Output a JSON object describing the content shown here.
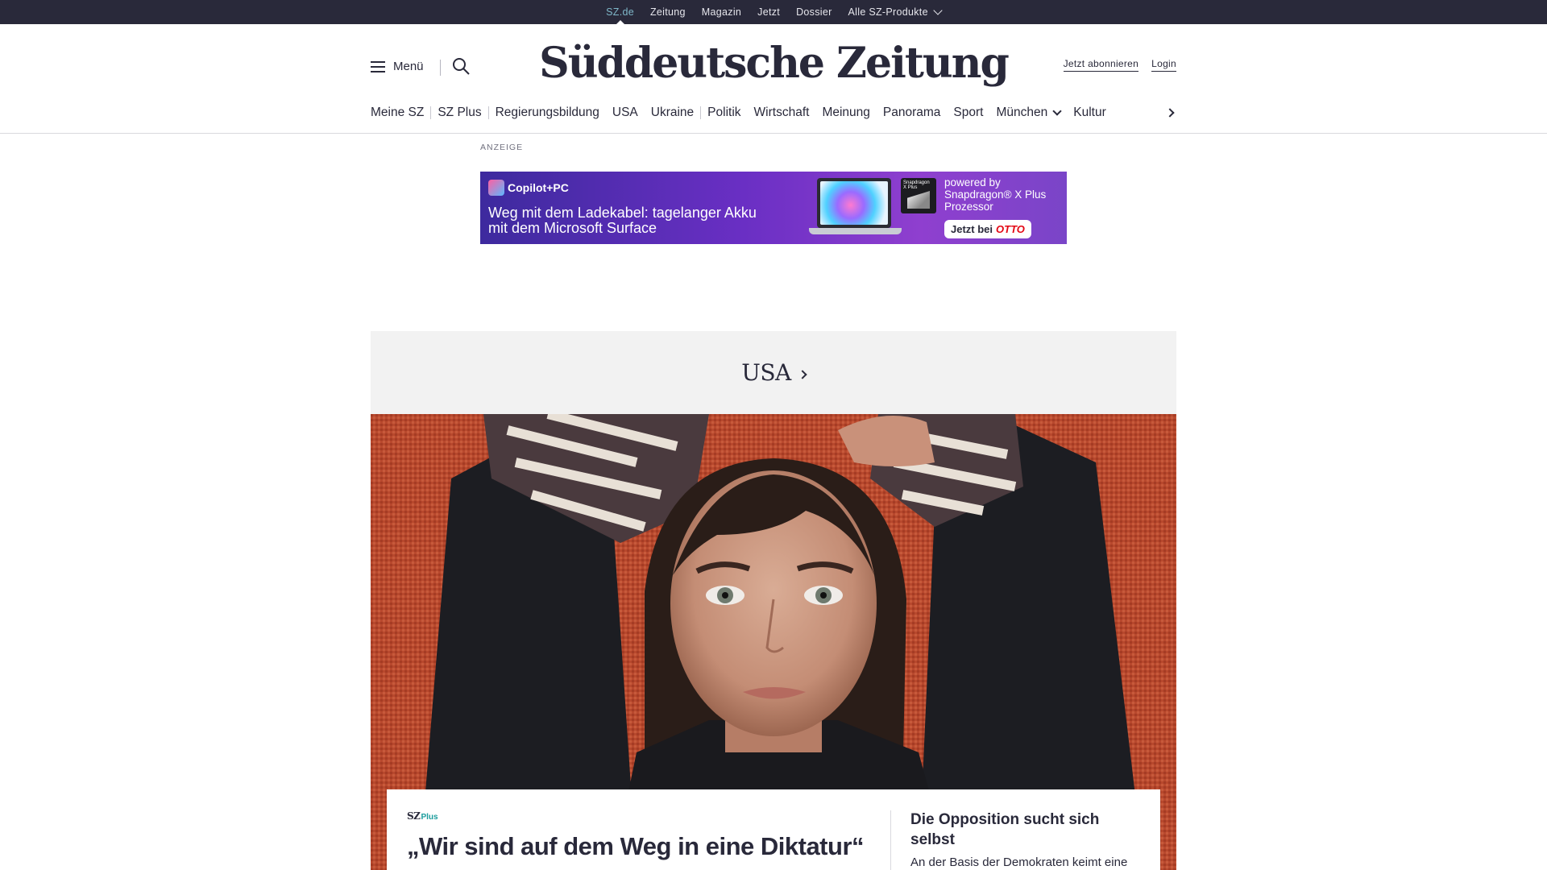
{
  "topbar": {
    "items": [
      "SZ.de",
      "Zeitung",
      "Magazin",
      "Jetzt",
      "Dossier",
      "Alle SZ-Produkte"
    ],
    "active": "SZ.de"
  },
  "header": {
    "menu_label": "Menü",
    "logo_text": "Süddeutsche Zeitung",
    "subscribe_label": "Jetzt abonnieren",
    "login_label": "Login"
  },
  "nav": {
    "items": [
      "Meine SZ",
      "SZ Plus",
      "Regierungsbildung",
      "USA",
      "Ukraine",
      "Politik",
      "Wirtschaft",
      "Meinung",
      "Panorama",
      "Sport",
      "München",
      "Kultur"
    ]
  },
  "ad": {
    "label": "ANZEIGE",
    "brand": "Copilot+PC",
    "headline": "Weg mit dem Ladekabel: tagelanger Akku mit dem Microsoft Surface",
    "chip_text": "Snapdragon X Plus",
    "powered": "powered by Snapdragon® X Plus Prozessor",
    "cta": "Jetzt bei",
    "cta_brand": "OTTO"
  },
  "section": {
    "title": "USA"
  },
  "teaser_main": {
    "badge_sz": "SZ",
    "badge_plus": "Plus",
    "headline": "„Wir sind auf dem Weg in eine Diktatur“"
  },
  "teaser_side": {
    "title": "Die Opposition sucht sich selbst",
    "text": "An der Basis der Demokraten keimt eine"
  },
  "colors": {
    "topbar_bg": "#29293a",
    "active_link": "#7fb7c9",
    "text": "#29293a",
    "section_bg": "#f2f2f2",
    "plus_accent": "#1a9c9c",
    "otto_red": "#e30613"
  }
}
